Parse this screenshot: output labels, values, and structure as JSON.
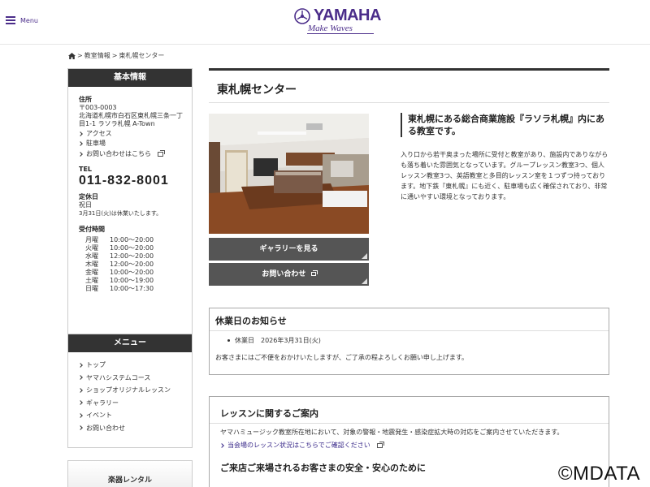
{
  "header": {
    "menu_label": "Menu",
    "logo_word": "YAMAHA",
    "logo_tagline": "Make Waves"
  },
  "breadcrumb": {
    "items": [
      "教室情報",
      "東札幌センター"
    ],
    "separator": ">"
  },
  "sidebar": {
    "basic": {
      "heading": "基本情報",
      "address_label": "住所",
      "postal": "〒003-0003",
      "address": "北海道札幌市白石区東札幌三条一丁目1-1 ラソラ札幌 A-Town",
      "links": [
        "アクセス",
        "駐車場",
        "お問い合わせはこちら"
      ],
      "tel_label": "TEL",
      "tel": "011-832-8001",
      "holiday_label": "定休日",
      "holiday": "祝日",
      "holiday_note": "3月31日(火)は休業いたします。",
      "hours_label": "受付時間",
      "hours": [
        {
          "day": "月曜",
          "time": "10:00〜20:00"
        },
        {
          "day": "火曜",
          "time": "10:00〜20:00"
        },
        {
          "day": "水曜",
          "time": "12:00〜20:00"
        },
        {
          "day": "木曜",
          "time": "12:00〜20:00"
        },
        {
          "day": "金曜",
          "time": "10:00〜20:00"
        },
        {
          "day": "土曜",
          "time": "10:00〜19:00"
        },
        {
          "day": "日曜",
          "time": "10:00〜17:30"
        }
      ]
    },
    "menu": {
      "heading": "メニュー",
      "items": [
        "トップ",
        "ヤマハシステムコース",
        "ショップオリジナルレッスン",
        "ギャラリー",
        "イベント",
        "お問い合わせ"
      ]
    },
    "rental_label": "楽器レンタル"
  },
  "main": {
    "title": "東札幌センター",
    "gallery_button": "ギャラリーを見る",
    "contact_button": "お問い合わせ",
    "intro_title": "東札幌にある総合商業施設『ラソラ札幌』内にある教室です。",
    "intro_body": "入り口から若干奥まった場所に受付と教室があり、施設内でありながらも落ち着いた雰囲気となっています。グループレッスン教室3つ、個人レッスン教室3つ、英語教室と多目的レッスン室を１つずつ持っております。地下鉄『東札幌』にも近く、駐車場も広く確保されており、非常に通いやすい環境となっております。",
    "notice": {
      "title": "休業日のお知らせ",
      "item": "休業日　2026年3月31日(火)",
      "message": "お客さまにはご不便をおかけいたしますが、ご了承の程よろしくお願い申し上げます。"
    },
    "lesson": {
      "title": "レッスンに関するご案内",
      "body": "ヤマハミュージック教室所在地において、対象の警報・地震発生・感染症拡大時の対応をご案内させていただきます。",
      "link": "当会場のレッスン状況はこちらでご確認ください",
      "subtitle": "ご来店ご来場されるお客さまの安全・安心のために"
    }
  },
  "watermark": "©MDATA",
  "colors": {
    "brand": "#4b2d8a",
    "dark": "#333333",
    "button": "#555555"
  }
}
